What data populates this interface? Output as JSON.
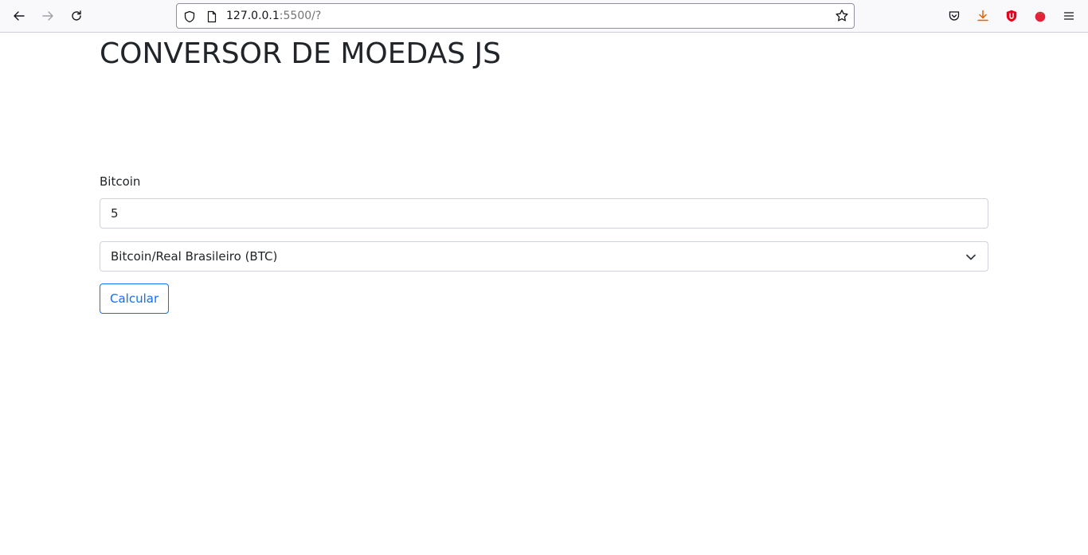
{
  "browser": {
    "url_host": "127.0.0.1",
    "url_rest": ":5500/?",
    "icons": [
      "back-arrow-icon",
      "forward-arrow-icon",
      "reload-icon",
      "shield-icon",
      "page-icon",
      "star-icon",
      "pocket-icon",
      "download-icon",
      "ublock-icon",
      "tomato-icon",
      "menu-icon"
    ]
  },
  "page": {
    "title": "CONVERSOR DE MOEDAS JS",
    "input_label": "Bitcoin",
    "input_value": "5",
    "select_value": "Bitcoin/Real Brasileiro (BTC)",
    "button_label": "Calcular"
  },
  "colors": {
    "primary": "#0d6efd",
    "text": "#212529",
    "download": "#e66000",
    "ublock": "#e8001c",
    "tomato": "#e8203a"
  }
}
